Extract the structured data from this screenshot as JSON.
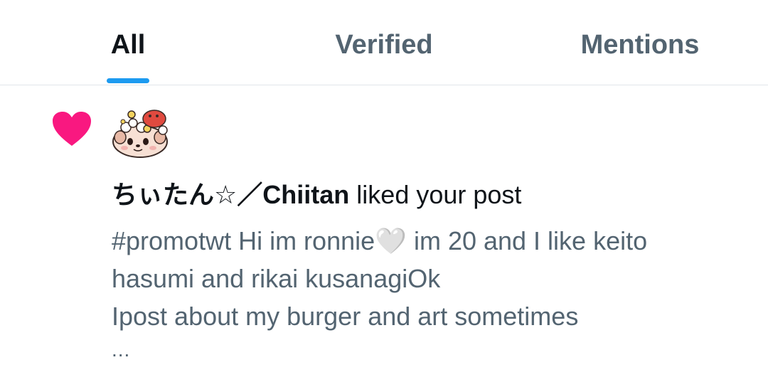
{
  "tabs": [
    {
      "label": "All",
      "active": true
    },
    {
      "label": "Verified",
      "active": false
    },
    {
      "label": "Mentions",
      "active": false
    }
  ],
  "notification": {
    "icon": "heart-icon",
    "icon_color": "#f91880",
    "avatar": "chiitan-avatar",
    "user_name": "ちぃたん☆／Chiitan",
    "action_text": "liked your post",
    "post_lines": [
      "#promotwt Hi im ronnie🤍 im 20 and I like keito",
      "hasumi and rikai kusanagiOk",
      "Ipost about my burger and art sometimes"
    ],
    "truncation": "..."
  },
  "colors": {
    "accent": "#1d9bf0",
    "primary_text": "#0f1419",
    "secondary_text": "#536471",
    "divider": "#e1e6ea"
  }
}
